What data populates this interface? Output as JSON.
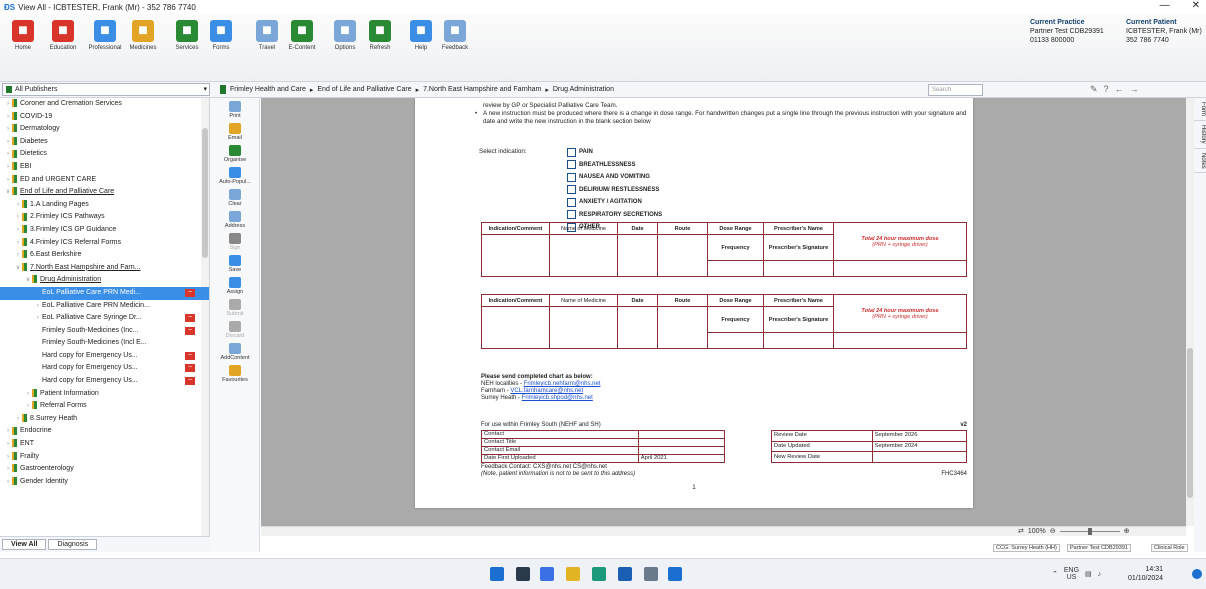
{
  "window": {
    "title": "View All - ICBTESTER, Frank (Mr) - 352 786 7740",
    "min_icon": "minimize-icon",
    "close_icon": "close-icon"
  },
  "ribbon": {
    "buttons": [
      {
        "label": "Home",
        "icon": "home-icon",
        "color": "#d9362b"
      },
      {
        "label": "Education",
        "icon": "education-icon",
        "color": "#d9362b"
      },
      {
        "label": "Professional",
        "icon": "professional-icon",
        "color": "#3a8ee6"
      },
      {
        "label": "Medicines",
        "icon": "medicines-icon",
        "color": "#e2a424"
      },
      {
        "label": "Services",
        "icon": "services-icon",
        "color": "#2a8a33"
      },
      {
        "label": "Forms",
        "icon": "forms-icon",
        "color": "#3a8ee6"
      },
      {
        "label": "Travel",
        "icon": "travel-icon",
        "color": "#7aa7d8"
      },
      {
        "label": "E-Content",
        "icon": "econtent-icon",
        "color": "#2a8a33"
      },
      {
        "label": "Options",
        "icon": "options-icon",
        "color": "#7aa7d8"
      },
      {
        "label": "Refresh",
        "icon": "refresh-icon",
        "color": "#2a8a33"
      },
      {
        "label": "Help",
        "icon": "help-icon",
        "color": "#3a8ee6"
      },
      {
        "label": "Feedback",
        "icon": "feedback-icon",
        "color": "#7aa7d8"
      }
    ],
    "practice_label": "Current Practice",
    "practice_name": "Partner Test CDB29391",
    "practice_phone": "01133 800000",
    "patient_label": "Current Patient",
    "patient_name": "ICBTESTER, Frank (Mr)",
    "patient_phone": "352 786 7740"
  },
  "nav": {
    "publisher": "All Publishers",
    "breadcrumbs": [
      "Frimley Health and Care",
      "End of Life and Palliative Care",
      "7.North East Hampshire and Farnham",
      "Drug Administration"
    ],
    "search_placeholder": "Search"
  },
  "tree": [
    {
      "label": "Coroner and Cremation Services",
      "level": 0,
      "state": "collapsed",
      "folder": true
    },
    {
      "label": "COVID-19",
      "level": 0,
      "state": "collapsed",
      "folder": true
    },
    {
      "label": "Dermatology",
      "level": 0,
      "state": "collapsed",
      "folder": true
    },
    {
      "label": "Diabetes",
      "level": 0,
      "state": "collapsed",
      "folder": true
    },
    {
      "label": "Dietetics",
      "level": 0,
      "state": "collapsed",
      "folder": true
    },
    {
      "label": "EBI",
      "level": 0,
      "state": "collapsed",
      "folder": true
    },
    {
      "label": "ED and URGENT CARE",
      "level": 0,
      "state": "collapsed",
      "folder": true
    },
    {
      "label": "End of Life and Palliative Care",
      "level": 0,
      "state": "expanded",
      "folder": true,
      "underline": true
    },
    {
      "label": "1.A Landing Pages",
      "level": 1,
      "state": "collapsed",
      "folder": true
    },
    {
      "label": "2.Frimley ICS Pathways",
      "level": 1,
      "state": "collapsed",
      "folder": true
    },
    {
      "label": "3.Frimley ICS GP Guidance",
      "level": 1,
      "state": "collapsed",
      "folder": true
    },
    {
      "label": "4.Frimley ICS Referral Forms",
      "level": 1,
      "state": "collapsed",
      "folder": true
    },
    {
      "label": "6.East Berkshire",
      "level": 1,
      "state": "collapsed",
      "folder": true
    },
    {
      "label": "7.North East Hampshire and Farn...",
      "level": 1,
      "state": "expanded",
      "folder": true,
      "underline": true
    },
    {
      "label": "Drug Administration",
      "level": 2,
      "state": "expanded",
      "folder": true,
      "underline": true
    },
    {
      "label": "EoL Palliative Care PRN Medi...",
      "level": 3,
      "state": "none",
      "folder": false,
      "selected": true,
      "tag": true
    },
    {
      "label": "EoL Palliative Care PRN Medicin...",
      "level": 3,
      "state": "leaf",
      "folder": false
    },
    {
      "label": "EoL Palliative Care Syringe Dr...",
      "level": 3,
      "state": "leaf",
      "folder": false,
      "tag": true
    },
    {
      "label": "Frimley South-Medicines (Inc...",
      "level": 3,
      "state": "none",
      "folder": false,
      "tag": true
    },
    {
      "label": "Frimley South-Medicines (Incl E...",
      "level": 3,
      "state": "none",
      "folder": false
    },
    {
      "label": "Hard copy for Emergency Us...",
      "level": 3,
      "state": "none",
      "folder": false,
      "tag": true
    },
    {
      "label": "Hard copy for Emergency Us...",
      "level": 3,
      "state": "none",
      "folder": false,
      "tag": true
    },
    {
      "label": "Hard copy for Emergency Us...",
      "level": 3,
      "state": "none",
      "folder": false,
      "tag": true
    },
    {
      "label": "Patient Information",
      "level": 2,
      "state": "collapsed",
      "folder": true
    },
    {
      "label": "Referral Forms",
      "level": 2,
      "state": "leaf",
      "folder": true
    },
    {
      "label": "8.Surrey Heath",
      "level": 1,
      "state": "collapsed",
      "folder": true
    },
    {
      "label": "Endocrine",
      "level": 0,
      "state": "collapsed",
      "folder": true
    },
    {
      "label": "ENT",
      "level": 0,
      "state": "collapsed",
      "folder": true
    },
    {
      "label": "Frailty",
      "level": 0,
      "state": "collapsed",
      "folder": true
    },
    {
      "label": "Gastroenterology",
      "level": 0,
      "state": "collapsed",
      "folder": true
    },
    {
      "label": "Gender Identity",
      "level": 0,
      "state": "collapsed",
      "folder": true
    }
  ],
  "tree_tabs": {
    "view_all": "View All",
    "diagnosis": "Diagnosis"
  },
  "actions": [
    {
      "label": "Print",
      "icon": "print-icon",
      "color": "#7aa7d8",
      "enabled": true
    },
    {
      "label": "Email",
      "icon": "email-icon",
      "color": "#e2a424",
      "enabled": true
    },
    {
      "label": "Organise",
      "icon": "organise-icon",
      "color": "#2a8a33",
      "enabled": true
    },
    {
      "label": "Auto-Popul...",
      "icon": "auto-populate-icon",
      "color": "#3a8ee6",
      "enabled": true
    },
    {
      "label": "Clear",
      "icon": "clear-icon",
      "color": "#7aa7d8",
      "enabled": true
    },
    {
      "label": "Address",
      "icon": "address-icon",
      "color": "#7aa7d8",
      "enabled": true
    },
    {
      "label": "Sign",
      "icon": "sign-icon",
      "color": "#888888",
      "enabled": false
    },
    {
      "label": "Save",
      "icon": "save-icon",
      "color": "#3a8ee6",
      "enabled": true
    },
    {
      "label": "Assign",
      "icon": "assign-icon",
      "color": "#3a8ee6",
      "enabled": true
    },
    {
      "label": "Submit",
      "icon": "submit-icon",
      "color": "#aaaaaa",
      "enabled": false
    },
    {
      "label": "Discard",
      "icon": "discard-icon",
      "color": "#aaaaaa",
      "enabled": false
    },
    {
      "label": "AddContent",
      "icon": "add-content-icon",
      "color": "#7aa7d8",
      "enabled": true
    },
    {
      "label": "Favourites",
      "icon": "star-icon",
      "color": "#e2a424",
      "enabled": true
    }
  ],
  "side_tabs": [
    "Form",
    "History",
    "Notes"
  ],
  "document": {
    "top_lines": [
      "review by GP or Specialist Palliative Care Team.",
      "A new instruction must be produced where there is a change in dose range. For handwritten changes put a single line through the previous instruction with your signature and date and write the new instruction in the blank section below"
    ],
    "select_label": "Select indication:",
    "indications": [
      "PAIN",
      "BREATHLESSNESS",
      "NAUSEA AND VOMITING",
      "DELIRIUM/ RESTLESSNESS",
      "ANXIETY / AGITATION",
      "RESPIRATORY SECRETIONS",
      "OTHER"
    ],
    "table_headers": [
      "Indication/Comment",
      "Name of Medicine",
      "Date",
      "Route",
      "Dose Range",
      "Prescriber's Name"
    ],
    "table_total": "Total 24 hour maximum dose",
    "table_total_note": "(PRN + syringe driver)",
    "table_frequency": "Frequency",
    "table_signature": "Prescriber's Signature",
    "send_title": "Please send completed chart as below:",
    "send_lines": [
      {
        "label": "NEH localities - ",
        "email": "Frimleyicb.nehfarm@nhs.net"
      },
      {
        "label": "Farnham - ",
        "email": "VCL.farnhamcare@nhs.net"
      },
      {
        "label": "Surrey Heath - ",
        "email": "Frimleyicb.shpod@nhs.net"
      }
    ],
    "use_within": "For use within Frimley South (NEHF and SH)",
    "version": "v2",
    "meta_left": [
      {
        "k": "Contact",
        "v": ""
      },
      {
        "k": "Contact Title",
        "v": ""
      },
      {
        "k": "Contact Email",
        "v": ""
      },
      {
        "k": "Date First Uploaded",
        "v": "April 2021"
      }
    ],
    "meta_right": [
      {
        "k": "Review Date",
        "v": "September 2026"
      },
      {
        "k": "Date Updated",
        "v": "September 2024"
      },
      {
        "k": "New Review Date",
        "v": ""
      }
    ],
    "feedback": "Feedback Contact: CXS@nhs.net CS@nhs.net",
    "note": "(Note, patient information is not to be sent to this address)",
    "ref": "FHC3464",
    "page_number": "1"
  },
  "viewer": {
    "zoom": "100%"
  },
  "status": [
    "CCG: Surrey Heath (HH)",
    "Partner Test CDB29391",
    "Clinical Role"
  ],
  "taskbar": {
    "lang": "ENG",
    "region": "US",
    "time": "14:31",
    "date": "01/10/2024",
    "icons": [
      {
        "name": "windows-start-icon",
        "color": "#1a6fd1"
      },
      {
        "name": "file-explorer-icon",
        "color": "#2b3a4a"
      },
      {
        "name": "search-taskbar-icon",
        "color": "#3a6fe6"
      },
      {
        "name": "folder-icon",
        "color": "#e2b424"
      },
      {
        "name": "edge-browser-icon",
        "color": "#1a9a7a"
      },
      {
        "name": "outlook-icon",
        "color": "#1a5fb4"
      },
      {
        "name": "network-drive-icon",
        "color": "#6a7a8a"
      },
      {
        "name": "app-ds-icon",
        "color": "#1a6fd1"
      }
    ]
  }
}
